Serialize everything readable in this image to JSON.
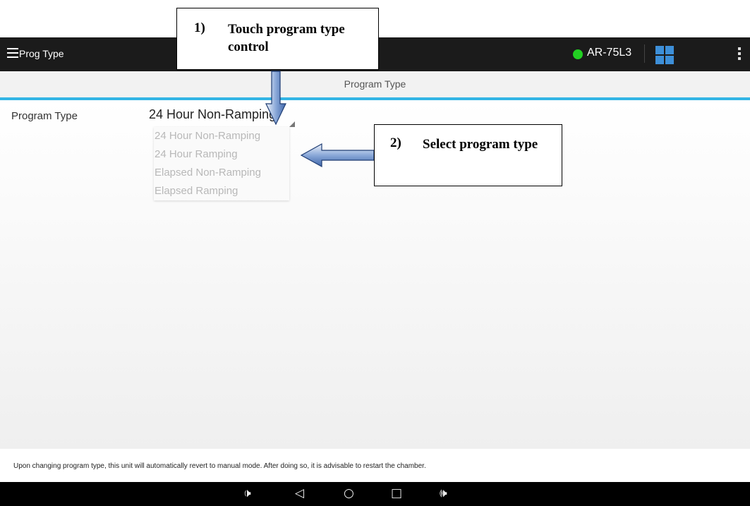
{
  "appbar": {
    "title": "Prog Type",
    "device_name": "AR-75L3",
    "status_color": "#22d022",
    "menu_icon": "hamburger-menu-icon",
    "app_icon": "grid-app-icon",
    "overflow_icon": "overflow-menu-icon"
  },
  "subheader": {
    "label": "Program Type"
  },
  "form": {
    "program_type_label": "Program Type",
    "program_type_value": "24 Hour Non-Ramping",
    "options": [
      "24 Hour Non-Ramping",
      "24 Hour Ramping",
      "Elapsed Non-Ramping",
      "Elapsed Ramping"
    ]
  },
  "footer_message": "Upon changing program type, this unit will automatically revert to manual mode.  After doing so, it is advisable to restart the chamber.",
  "navbar": {
    "volume_down": "🕩",
    "back": "◁",
    "home": "○",
    "recents": "□",
    "volume_up": "🕪"
  },
  "annotations": {
    "step1_num": "1)",
    "step1_text": "Touch program type control",
    "step2_num": "2)",
    "step2_text": "Select program type"
  }
}
